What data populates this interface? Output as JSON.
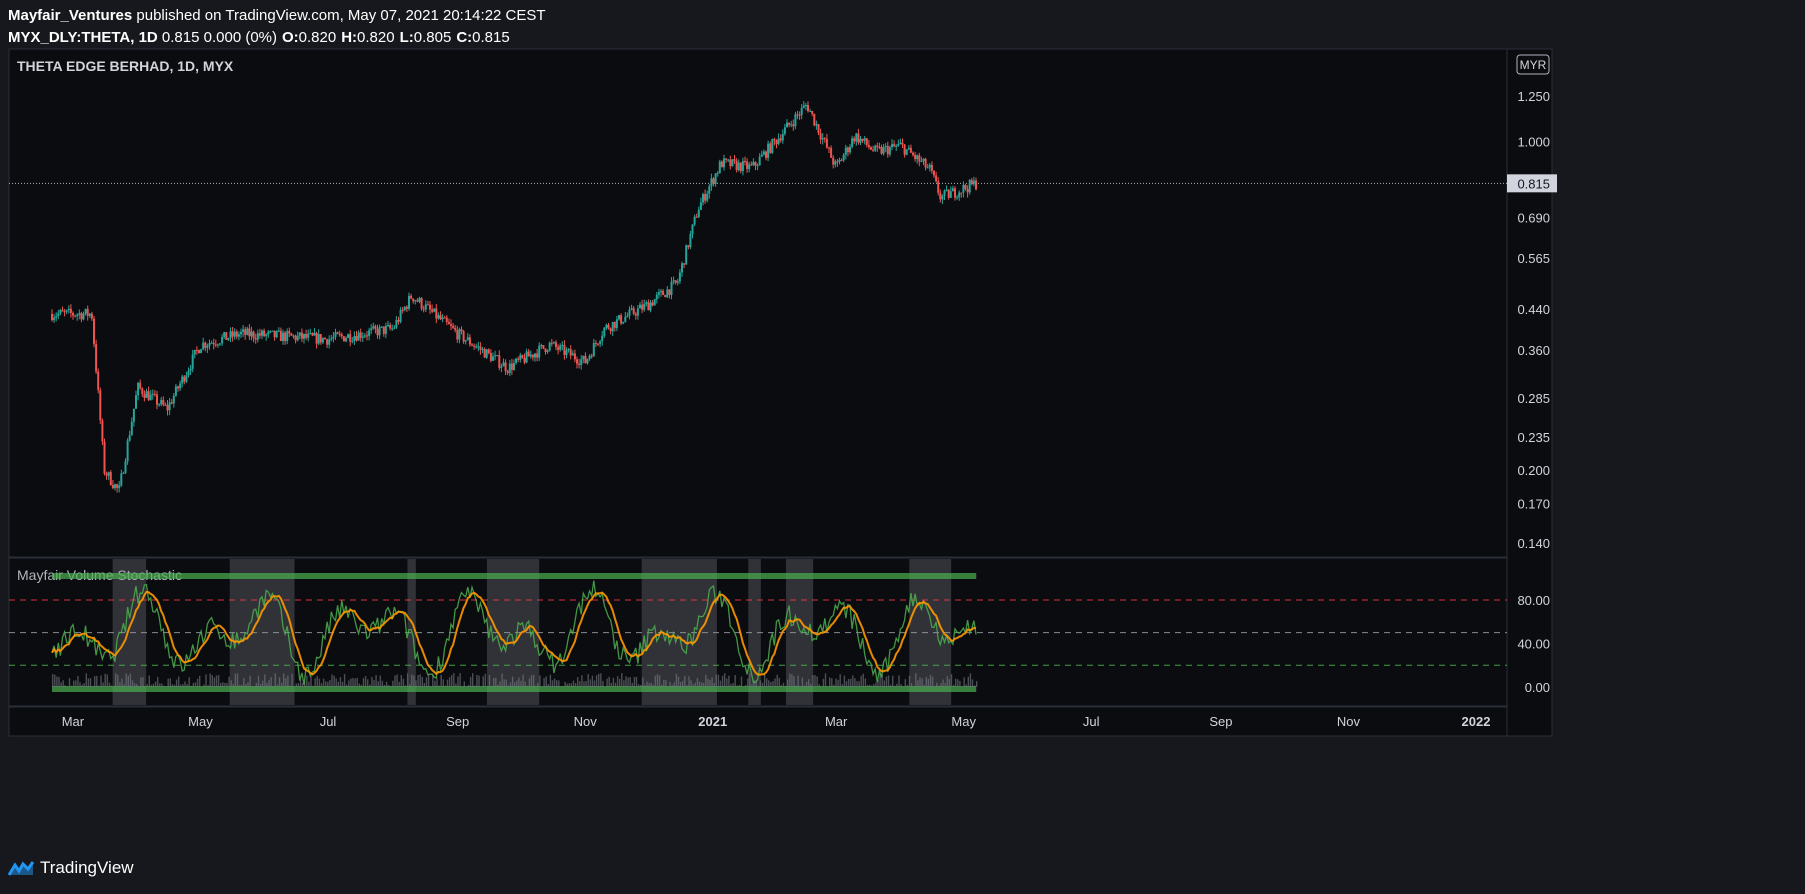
{
  "header": {
    "author": "Mayfair_Ventures",
    "published": "published on TradingView.com, May 07, 2021 20:14:22 CEST",
    "symbol": "MYX_DLY:THETA, 1D",
    "change": "0.815 0.000 (0%)",
    "o_label": "O:",
    "o_value": "0.820",
    "h_label": "H:",
    "h_value": "0.820",
    "l_label": "L:",
    "l_value": "0.805",
    "c_label": "C:",
    "c_value": "0.815"
  },
  "footer": {
    "brand": "TradingView"
  },
  "colors": {
    "up": "#26a69a",
    "down": "#ef5350",
    "stoch_fast": "#4caf50",
    "stoch_slow": "#ff9800",
    "band_upper": "#f23645",
    "band_lower": "#4caf50",
    "bg": "#0b0c0f"
  },
  "chart_data": [
    {
      "type": "candlestick",
      "title": "THETA EDGE BERHAD, 1D, MYX",
      "currency": "MYR",
      "last_price": "0.815",
      "yscale": "log",
      "ylim": [
        0.14,
        1.32
      ],
      "y_ticks": [
        "1.250",
        "1.000",
        "0.815",
        "0.690",
        "0.565",
        "0.440",
        "0.360",
        "0.285",
        "0.235",
        "0.200",
        "0.170",
        "0.140"
      ],
      "x_ticks": [
        "Mar",
        "May",
        "Jul",
        "Sep",
        "Nov",
        "2021",
        "Mar",
        "May",
        "Jul",
        "Sep",
        "Nov",
        "2022"
      ],
      "closes_approx": [
        {
          "date": "2020-02-20",
          "close": 0.43
        },
        {
          "date": "2020-03-10",
          "close": 0.43
        },
        {
          "date": "2020-03-16",
          "close": 0.2
        },
        {
          "date": "2020-03-23",
          "close": 0.18
        },
        {
          "date": "2020-04-01",
          "close": 0.3
        },
        {
          "date": "2020-04-15",
          "close": 0.27
        },
        {
          "date": "2020-05-01",
          "close": 0.37
        },
        {
          "date": "2020-05-20",
          "close": 0.39
        },
        {
          "date": "2020-07-01",
          "close": 0.38
        },
        {
          "date": "2020-08-01",
          "close": 0.4
        },
        {
          "date": "2020-08-10",
          "close": 0.47
        },
        {
          "date": "2020-09-01",
          "close": 0.39
        },
        {
          "date": "2020-09-25",
          "close": 0.33
        },
        {
          "date": "2020-10-15",
          "close": 0.37
        },
        {
          "date": "2020-11-01",
          "close": 0.34
        },
        {
          "date": "2020-11-10",
          "close": 0.4
        },
        {
          "date": "2020-12-01",
          "close": 0.45
        },
        {
          "date": "2020-12-15",
          "close": 0.5
        },
        {
          "date": "2020-12-25",
          "close": 0.72
        },
        {
          "date": "2021-01-05",
          "close": 0.9
        },
        {
          "date": "2021-01-20",
          "close": 0.88
        },
        {
          "date": "2021-02-15",
          "close": 1.2
        },
        {
          "date": "2021-03-01",
          "close": 0.88
        },
        {
          "date": "2021-03-10",
          "close": 1.03
        },
        {
          "date": "2021-03-20",
          "close": 0.95
        },
        {
          "date": "2021-04-01",
          "close": 0.98
        },
        {
          "date": "2021-04-15",
          "close": 0.87
        },
        {
          "date": "2021-04-20",
          "close": 0.76
        },
        {
          "date": "2021-05-07",
          "close": 0.815
        }
      ]
    },
    {
      "type": "line",
      "title": "Mayfair Volume Stochastic",
      "ylim": [
        -10,
        110
      ],
      "y_ticks": [
        "80.00",
        "40.00",
        "0.00"
      ],
      "levels": [
        80,
        50,
        20
      ],
      "series": [],
      "shaded_periods": [
        {
          "start": "2020-03-20",
          "end": "2020-04-05"
        },
        {
          "start": "2020-05-15",
          "end": "2020-06-15"
        },
        {
          "start": "2020-08-08",
          "end": "2020-08-12"
        },
        {
          "start": "2020-09-15",
          "end": "2020-10-10"
        },
        {
          "start": "2020-11-28",
          "end": "2021-01-03"
        },
        {
          "start": "2021-01-18",
          "end": "2021-01-24"
        },
        {
          "start": "2021-02-05",
          "end": "2021-02-18"
        },
        {
          "start": "2021-04-05",
          "end": "2021-04-25"
        }
      ]
    }
  ]
}
